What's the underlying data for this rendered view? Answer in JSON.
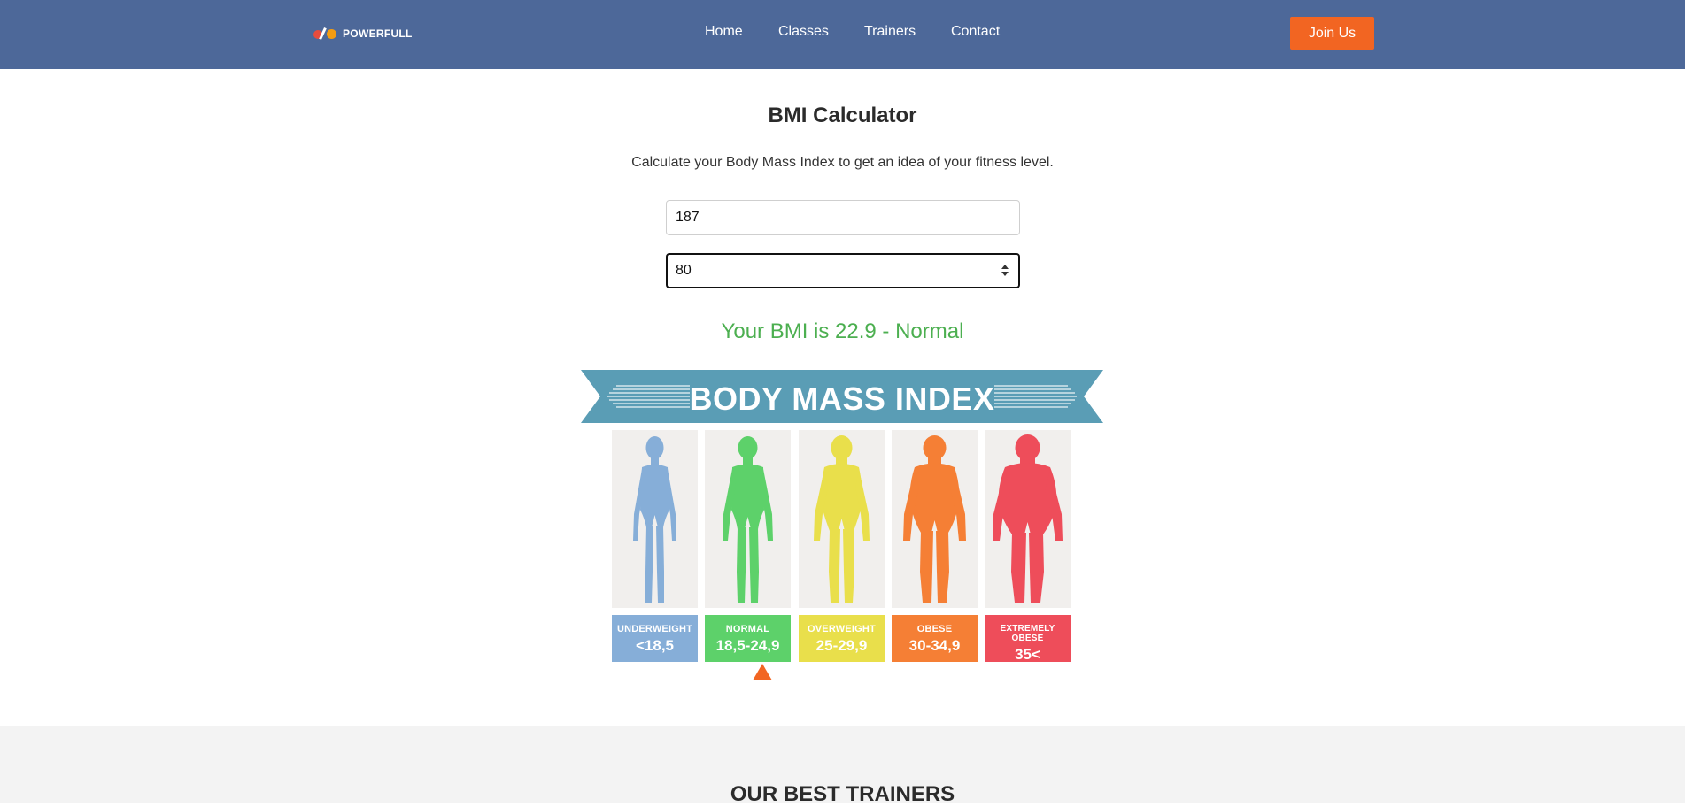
{
  "header": {
    "logo_text": "POWERFULL",
    "nav": [
      "Home",
      "Classes",
      "Trainers",
      "Contact"
    ],
    "join_label": "Join Us",
    "background": "#4d6899",
    "accent": "#f26522"
  },
  "bmi": {
    "title": "BMI Calculator",
    "subtitle": "Calculate your Body Mass Index to get an idea of your fitness level.",
    "height_value": "187",
    "weight_value": "80",
    "result": "Your BMI is 22.9 - Normal",
    "result_color": "#4caf50"
  },
  "infographic": {
    "title": "BODY MASS INDEX",
    "banner_color": "#5a9db5",
    "categories": [
      {
        "name": "UNDERWEIGHT",
        "range": "<18,5",
        "color": "#86aed8"
      },
      {
        "name": "NORMAL",
        "range": "18,5-24,9",
        "color": "#5dd16a"
      },
      {
        "name": "OVERWEIGHT",
        "range": "25-29,9",
        "color": "#e9df4b"
      },
      {
        "name": "OBESE",
        "range": "30-34,9",
        "color": "#f57f35"
      },
      {
        "name": "EXTREMELY OBESE",
        "range": "35<",
        "color": "#ee4d5a"
      }
    ],
    "selected_category": "NORMAL"
  },
  "trainers": {
    "title": "OUR BEST TRAINERS"
  }
}
